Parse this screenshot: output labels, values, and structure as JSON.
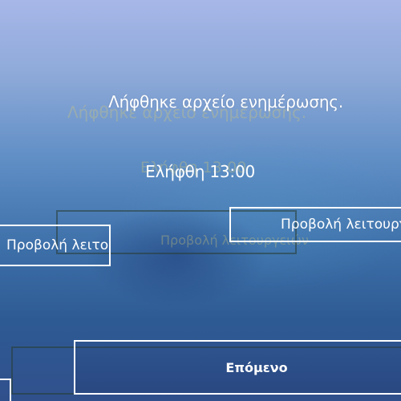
{
  "notification": {
    "title": "Λήφθηκε αρχείο ενημέρωσης.",
    "time": "Ελήφθη 13:00"
  },
  "buttons": {
    "view_features": "Προβολή λειτουργειών",
    "next": "Επόμενο"
  },
  "colors": {
    "background_top": "#a7b7e8",
    "background_bottom": "#30508c",
    "text": "#ffffff",
    "frame": "#ffffff"
  }
}
